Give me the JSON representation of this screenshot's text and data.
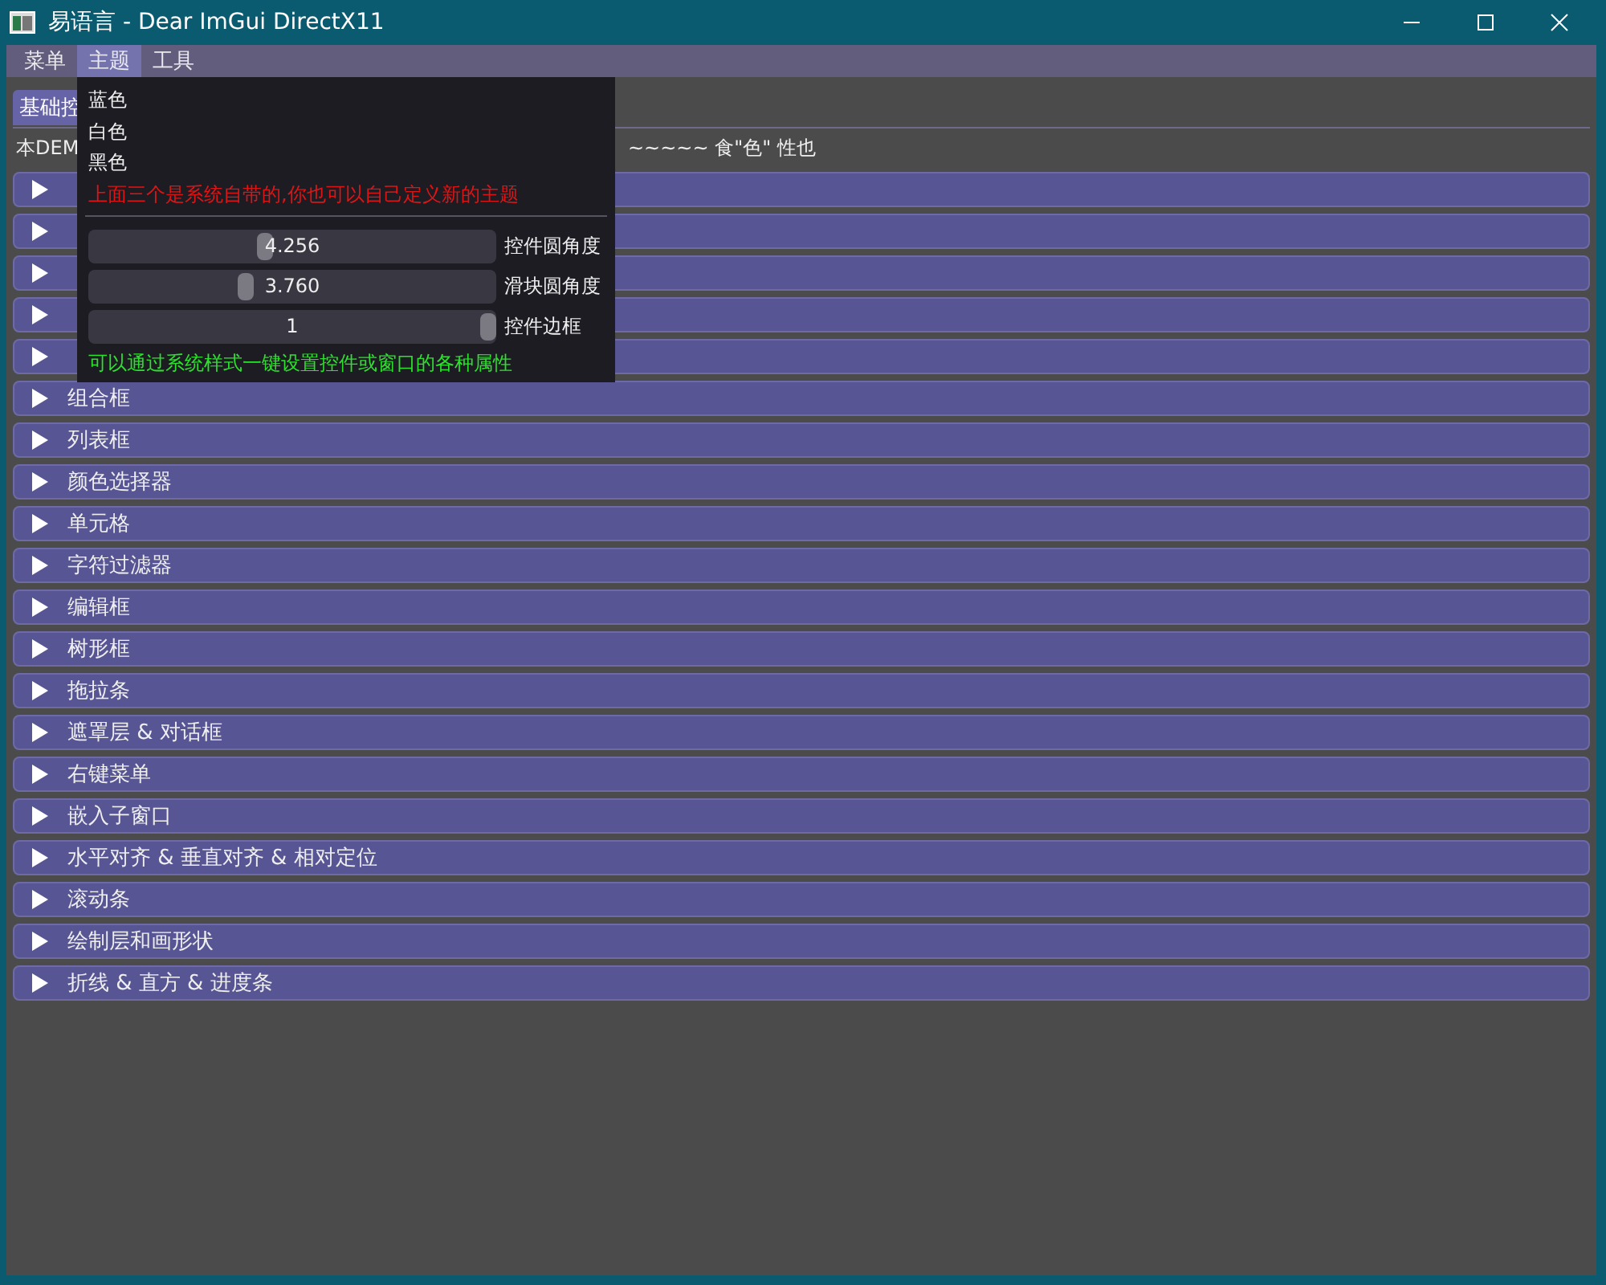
{
  "window": {
    "title": "易语言 - Dear ImGui DirectX11"
  },
  "menu_bar": [
    {
      "label": "菜单",
      "selected": false
    },
    {
      "label": "主题",
      "selected": true
    },
    {
      "label": "工具",
      "selected": false
    }
  ],
  "tabs": [
    {
      "label": "基础控",
      "selected": true
    }
  ],
  "info_line": {
    "start": "本DEM",
    "end": "~~~~~ 食\"色\" 性也"
  },
  "headers": [
    {
      "expanded": false
    },
    {
      "expanded": false
    },
    {
      "expanded": false
    },
    {
      "expanded": false
    },
    {
      "expanded": false
    },
    {
      "label": "组合框",
      "expanded": false
    },
    {
      "label": "列表框",
      "expanded": false
    },
    {
      "label": "颜色选择器",
      "expanded": false
    },
    {
      "label": "单元格",
      "expanded": false
    },
    {
      "label": "字符过滤器",
      "expanded": false
    },
    {
      "label": "编辑框",
      "expanded": false
    },
    {
      "label": "树形框",
      "expanded": false
    },
    {
      "label": "拖拉条",
      "expanded": false
    },
    {
      "label": "遮罩层 & 对话框",
      "expanded": false
    },
    {
      "label": "右键菜单",
      "expanded": false
    },
    {
      "label": "嵌入子窗口",
      "expanded": false
    },
    {
      "label": "水平对齐 & 垂直对齐 & 相对定位",
      "expanded": false
    },
    {
      "label": "滚动条",
      "expanded": false
    },
    {
      "label": "绘制层和画形状",
      "expanded": false
    },
    {
      "label": "折线 & 直方 & 进度条",
      "expanded": false
    }
  ],
  "theme_menu": {
    "items": [
      "蓝色",
      "白色",
      "黑色"
    ],
    "note": "上面三个是系统自带的,你也可以自己定义新的主题",
    "sliders": [
      {
        "value": "4.256",
        "label": "控件圆角度",
        "level": 0.43
      },
      {
        "value": "3.760",
        "label": "滑块圆角度",
        "level": 0.38
      },
      {
        "value": "1",
        "label": "控件边框",
        "level": 1
      }
    ],
    "footer": "可以通过系统样式一键设置控件或窗口的各种属性"
  }
}
